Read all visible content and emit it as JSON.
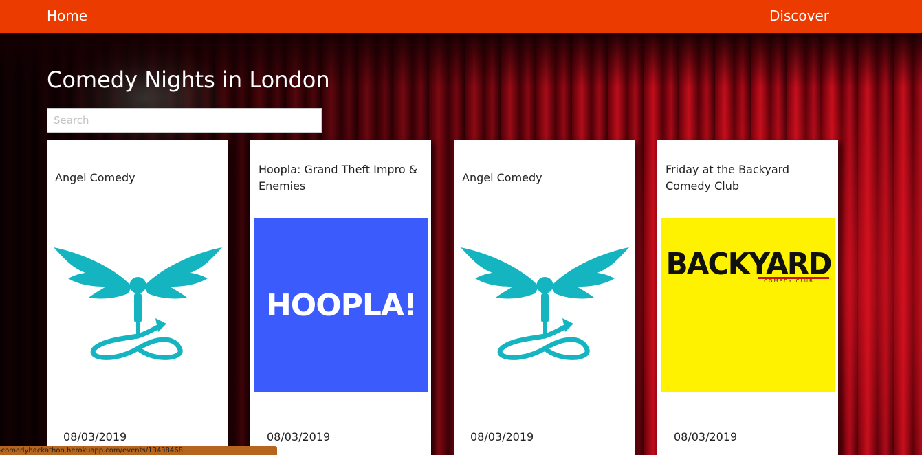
{
  "nav": {
    "home": "Home",
    "discover": "Discover"
  },
  "page": {
    "title": "Comedy Nights in London"
  },
  "search": {
    "placeholder": "Search",
    "value": ""
  },
  "events": [
    {
      "title": "Angel Comedy",
      "date": "08/03/2019",
      "logo": "angel-comedy-logo"
    },
    {
      "title": "Hoopla: Grand Theft Impro & Enemies",
      "date": "08/03/2019",
      "logo": "hoopla-logo",
      "logo_text": "HOOPLA!",
      "logo_bg": "#3b5bfd"
    },
    {
      "title": "Angel Comedy",
      "date": "08/03/2019",
      "logo": "angel-comedy-logo"
    },
    {
      "title": "Friday at the Backyard Comedy Club",
      "date": "08/03/2019",
      "logo": "backyard-logo",
      "logo_text": "BACKYARD",
      "logo_subtext": "COMEDY CLUB",
      "logo_bg": "#fff200"
    }
  ],
  "status": {
    "url": "-comedyhackathon.herokuapp.com/events/13438468"
  },
  "colors": {
    "navbar": "#eb3b00",
    "angel_teal": "#14b4c0"
  }
}
